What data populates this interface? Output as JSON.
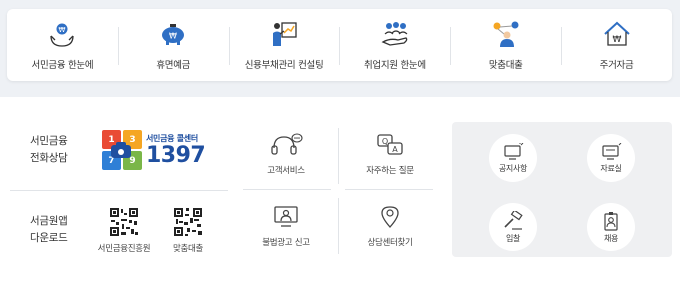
{
  "services": [
    {
      "label": "서민금융 한눈에",
      "icon": "hands-coin-icon"
    },
    {
      "label": "휴면예금",
      "icon": "piggy-bank-icon"
    },
    {
      "label": "신용부채관리 컨설팅",
      "icon": "consultant-board-icon"
    },
    {
      "label": "취업지원 한눈에",
      "icon": "people-hand-icon"
    },
    {
      "label": "맞춤대출",
      "icon": "person-network-icon"
    },
    {
      "label": "주거자금",
      "icon": "house-won-icon"
    }
  ],
  "consult": {
    "title_line1": "서민금융",
    "title_line2": "전화상담",
    "callcenter_sub": "서민금융 콜센터",
    "callcenter_number": "1397",
    "logo_digits": [
      "1",
      "3",
      "7",
      "9"
    ]
  },
  "apps": {
    "title_line1": "서금원앱",
    "title_line2": "다운로드",
    "items": [
      {
        "label": "서민금융진흥원"
      },
      {
        "label": "맞춤대출"
      }
    ]
  },
  "quick_links": [
    {
      "label": "고객서비스",
      "icon": "headset-chat-icon"
    },
    {
      "label": "자주하는 질문",
      "icon": "qa-bubble-icon"
    },
    {
      "label": "불법광고 신고",
      "icon": "monitor-person-icon"
    },
    {
      "label": "상담센터찾기",
      "icon": "location-pin-icon"
    }
  ],
  "notice_links": [
    {
      "label": "공지사항",
      "icon": "notice-monitor-icon"
    },
    {
      "label": "자료실",
      "icon": "archive-monitor-icon"
    },
    {
      "label": "입찰",
      "icon": "gavel-icon"
    },
    {
      "label": "채용",
      "icon": "id-badge-icon"
    }
  ],
  "colors": {
    "brand_blue": "#1f4fa0",
    "accent_orange": "#f5a623",
    "logo_red": "#e94b35",
    "logo_green": "#7ab648",
    "logo_blue": "#2f7fd6"
  }
}
